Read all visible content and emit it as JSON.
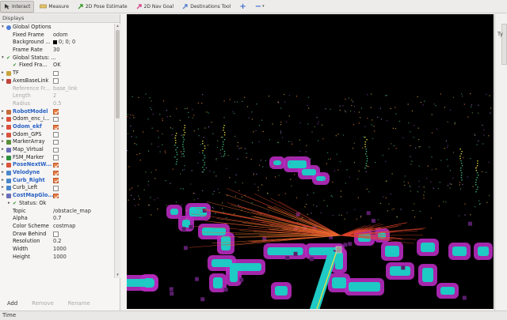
{
  "toolbar": {
    "interact": "Interact",
    "measure": "Measure",
    "pose_estimate": "2D Pose Estimate",
    "nav_goal": "2D Nav Goal",
    "destinations": "Destinations Tool",
    "plus": "+",
    "minus": "−"
  },
  "displays": {
    "title": "Displays",
    "rows": [
      {
        "indent": 0,
        "icon": "globe-icon",
        "name": "Global Options",
        "val": "",
        "cb": null,
        "style": "",
        "exp": "▾"
      },
      {
        "indent": 1,
        "icon": "",
        "name": "Fixed Frame",
        "val": "odom",
        "cb": null,
        "style": "",
        "exp": ""
      },
      {
        "indent": 1,
        "icon": "",
        "name": "Background ...",
        "val": "0; 0; 0",
        "cb": null,
        "style": "",
        "exp": "",
        "swatch": true
      },
      {
        "indent": 1,
        "icon": "",
        "name": "Frame Rate",
        "val": "30",
        "cb": null,
        "style": "",
        "exp": ""
      },
      {
        "indent": 0,
        "icon": "check-icon",
        "name": "Global Status: ...",
        "val": "",
        "cb": null,
        "style": "",
        "exp": "▾"
      },
      {
        "indent": 1,
        "icon": "check-icon",
        "name": "Fixed Fra...",
        "val": "OK",
        "cb": null,
        "style": "",
        "exp": ""
      },
      {
        "indent": 0,
        "icon": "tf-icon",
        "name": "TF",
        "val": "",
        "cb": false,
        "style": "",
        "exp": "▸"
      },
      {
        "indent": 0,
        "icon": "axes-icon",
        "name": "AxesBaseLink",
        "val": "",
        "cb": false,
        "style": "",
        "exp": "▾"
      },
      {
        "indent": 1,
        "icon": "",
        "name": "Reference Fr...",
        "val": "base_link",
        "cb": null,
        "style": "dis",
        "exp": ""
      },
      {
        "indent": 1,
        "icon": "",
        "name": "Length",
        "val": "2",
        "cb": null,
        "style": "dis",
        "exp": ""
      },
      {
        "indent": 1,
        "icon": "",
        "name": "Radius",
        "val": "0.5",
        "cb": null,
        "style": "dis",
        "exp": ""
      },
      {
        "indent": 0,
        "icon": "robot-icon",
        "name": "RobotModel",
        "val": "",
        "cb": true,
        "style": "blue",
        "exp": "▸"
      },
      {
        "indent": 0,
        "icon": "odom-icon",
        "name": "Odom_enc_i...",
        "val": "",
        "cb": false,
        "style": "",
        "exp": "▸"
      },
      {
        "indent": 0,
        "icon": "odom-icon",
        "name": "Odom_ekf",
        "val": "",
        "cb": true,
        "style": "blue",
        "exp": "▸"
      },
      {
        "indent": 0,
        "icon": "odom-icon",
        "name": "Odom_GPS",
        "val": "",
        "cb": false,
        "style": "",
        "exp": "▸"
      },
      {
        "indent": 0,
        "icon": "marker-icon",
        "name": "MarkerArray",
        "val": "",
        "cb": false,
        "style": "",
        "exp": "▸"
      },
      {
        "indent": 0,
        "icon": "map-icon",
        "name": "Map_Virtual",
        "val": "",
        "cb": false,
        "style": "",
        "exp": "▸"
      },
      {
        "indent": 0,
        "icon": "fsm-icon",
        "name": "FSM_Marker",
        "val": "",
        "cb": false,
        "style": "",
        "exp": "▸"
      },
      {
        "indent": 0,
        "icon": "pose-icon",
        "name": "PoseNextW...",
        "val": "",
        "cb": true,
        "style": "blue",
        "exp": "▸"
      },
      {
        "indent": 0,
        "icon": "cloud-icon",
        "name": "Velodyne",
        "val": "",
        "cb": true,
        "style": "blue",
        "exp": "▸"
      },
      {
        "indent": 0,
        "icon": "cloud-icon",
        "name": "Curb_Right",
        "val": "",
        "cb": true,
        "style": "blue",
        "exp": "▸"
      },
      {
        "indent": 0,
        "icon": "cloud-icon",
        "name": "Curb_Left",
        "val": "",
        "cb": false,
        "style": "",
        "exp": "▸"
      },
      {
        "indent": 0,
        "icon": "map-icon",
        "name": "CostMapGlo...",
        "val": "",
        "cb": true,
        "style": "blue",
        "exp": "▾"
      },
      {
        "indent": 1,
        "icon": "check-icon",
        "name": "Status: Ok",
        "val": "",
        "cb": null,
        "style": "",
        "exp": "▸"
      },
      {
        "indent": 1,
        "icon": "",
        "name": "Topic",
        "val": "/obstacle_map",
        "cb": null,
        "style": "",
        "exp": ""
      },
      {
        "indent": 1,
        "icon": "",
        "name": "Alpha",
        "val": "0.7",
        "cb": null,
        "style": "",
        "exp": ""
      },
      {
        "indent": 1,
        "icon": "",
        "name": "Color Scheme",
        "val": "costmap",
        "cb": null,
        "style": "",
        "exp": ""
      },
      {
        "indent": 1,
        "icon": "",
        "name": "Draw Behind",
        "val": "",
        "cb": false,
        "style": "",
        "exp": ""
      },
      {
        "indent": 1,
        "icon": "",
        "name": "Resolution",
        "val": "0.2",
        "cb": null,
        "style": "",
        "exp": ""
      },
      {
        "indent": 1,
        "icon": "",
        "name": "Width",
        "val": "1000",
        "cb": null,
        "style": "",
        "exp": ""
      },
      {
        "indent": 1,
        "icon": "",
        "name": "Height",
        "val": "1000",
        "cb": null,
        "style": "",
        "exp": ""
      }
    ],
    "add": "Add",
    "remove": "Remove",
    "rename": "Rename"
  },
  "right_panel_label": "Ty",
  "status_bar": "Time",
  "colors": {
    "accent": "#2a62c4",
    "checkbox": "#e57b44",
    "viewport_bg": "#000000",
    "costmap_cyan": "#1fc9c4",
    "costmap_magenta": "#b62bbf"
  }
}
